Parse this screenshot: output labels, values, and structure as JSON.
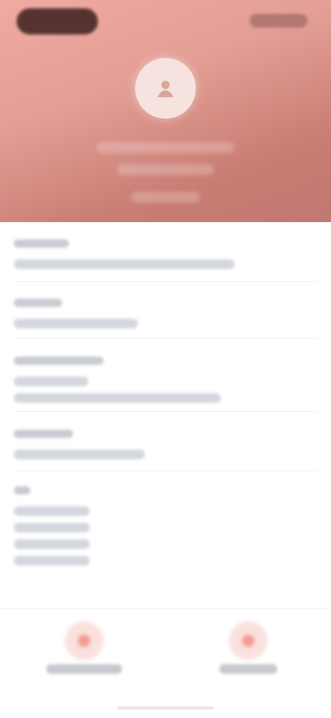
{
  "header": {
    "status_bar": {
      "left": "",
      "right": ""
    },
    "avatar": {
      "icon": "person-icon"
    },
    "title": "",
    "subtitle": "",
    "detail": ""
  },
  "content": {
    "fields": [
      {
        "label": "",
        "value": ""
      },
      {
        "label": "",
        "value": ""
      },
      {
        "label": "",
        "value": "",
        "value2": ""
      },
      {
        "label": "",
        "value": ""
      },
      {
        "label": "",
        "values": [
          "",
          "",
          "",
          ""
        ]
      }
    ]
  },
  "bottom_nav": {
    "items": [
      {
        "icon": "left-nav-icon",
        "label": ""
      },
      {
        "icon": "right-nav-icon",
        "label": ""
      }
    ]
  },
  "colors": {
    "header_primary": "#f0aaa2",
    "header_secondary": "#c07870",
    "accent": "#f29b90",
    "background": "#ffffff"
  }
}
